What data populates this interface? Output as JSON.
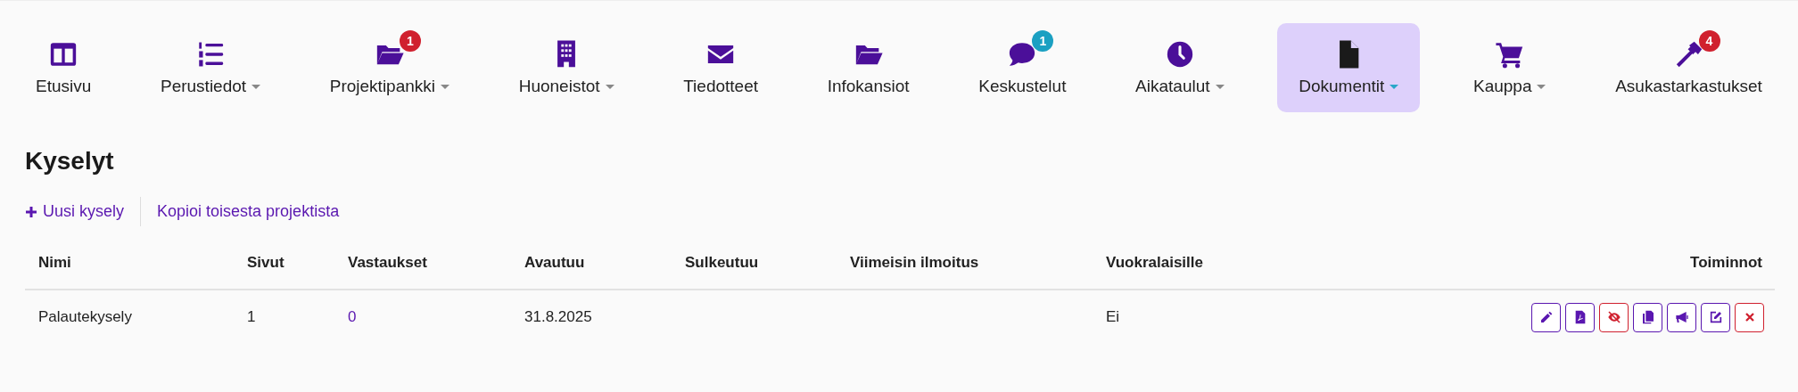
{
  "nav": [
    {
      "label": "Etusivu",
      "kind": "columns",
      "dropdown": false,
      "selected": false
    },
    {
      "label": "Perustiedot",
      "kind": "list",
      "dropdown": true,
      "selected": false
    },
    {
      "label": "Projektipankki",
      "kind": "folder",
      "dropdown": true,
      "selected": false,
      "badge": {
        "count": "1",
        "color": "#d0202e"
      }
    },
    {
      "label": "Huoneistot",
      "kind": "building",
      "dropdown": true,
      "selected": false
    },
    {
      "label": "Tiedotteet",
      "kind": "envelope",
      "dropdown": false,
      "selected": false
    },
    {
      "label": "Infokansiot",
      "kind": "folder",
      "dropdown": false,
      "selected": false
    },
    {
      "label": "Keskustelut",
      "kind": "chat",
      "dropdown": false,
      "selected": false,
      "badge": {
        "count": "1",
        "color": "#1ba0c2"
      }
    },
    {
      "label": "Aikataulut",
      "kind": "clock",
      "dropdown": true,
      "selected": false
    },
    {
      "label": "Dokumentit",
      "kind": "file",
      "dropdown": true,
      "selected": true
    },
    {
      "label": "Kauppa",
      "kind": "cart",
      "dropdown": true,
      "selected": false
    },
    {
      "label": "Asukastarkastukset",
      "kind": "hammer",
      "dropdown": false,
      "selected": false,
      "badge": {
        "count": "4",
        "color": "#d0202e"
      }
    }
  ],
  "heading": "Kyselyt",
  "links": [
    {
      "label": "Uusi kysely",
      "plus": true
    },
    {
      "label": "Kopioi toisesta projektista",
      "plus": false
    }
  ],
  "table": {
    "columns": [
      "Nimi",
      "Sivut",
      "Vastaukset",
      "Avautuu",
      "Sulkeutuu",
      "Viimeisin ilmoitus",
      "Vuokralaisille",
      "Toiminnot"
    ],
    "rows": [
      {
        "cells": [
          {
            "kind": "text",
            "text": "Palautekysely"
          },
          {
            "kind": "text",
            "text": "1"
          },
          {
            "kind": "link",
            "text": "0"
          },
          {
            "kind": "text",
            "text": "31.8.2025"
          },
          {
            "kind": "empty"
          },
          {
            "kind": "empty"
          },
          {
            "kind": "text",
            "text": "Ei"
          }
        ],
        "actions": [
          {
            "kind": "pencil",
            "color": "#5a17b0"
          },
          {
            "kind": "pdf",
            "color": "#5a17b0"
          },
          {
            "kind": "eye-slash",
            "color": "#d0202e"
          },
          {
            "kind": "copy",
            "color": "#5a17b0"
          },
          {
            "kind": "megaphone",
            "color": "#5a17b0"
          },
          {
            "kind": "edit",
            "color": "#5a17b0"
          },
          {
            "kind": "close",
            "color": "#d0202e"
          }
        ]
      }
    ]
  }
}
